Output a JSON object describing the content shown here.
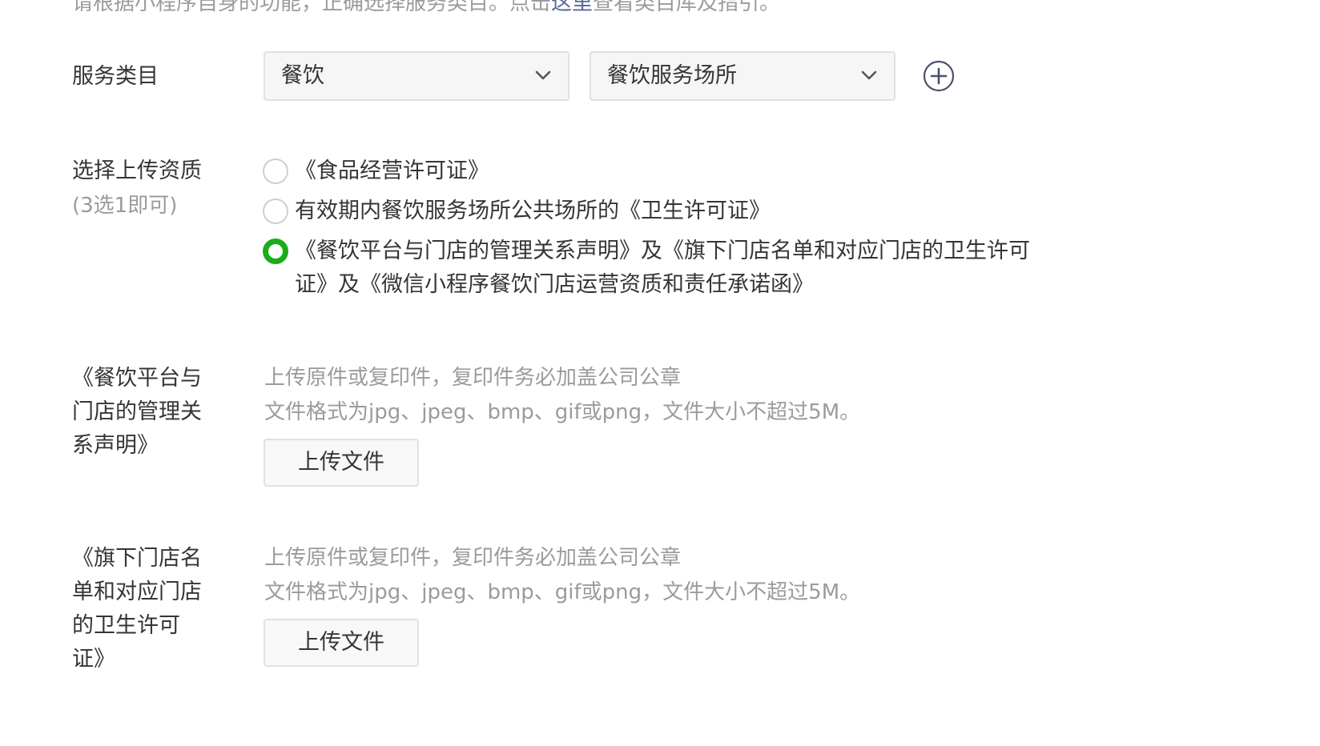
{
  "intro": {
    "text_before": "请根据小程序自身的功能，正确选择服务类目。点击",
    "link": "这里",
    "text_after": "查看类目库及指引。"
  },
  "service_category": {
    "label": "服务类目",
    "primary": "餐饮",
    "secondary": "餐饮服务场所"
  },
  "qualification": {
    "label": "选择上传资质",
    "sublabel": "(3选1即可)",
    "options": [
      {
        "text": "《食品经营许可证》",
        "checked": false
      },
      {
        "text": "有效期内餐饮服务场所公共场所的《卫生许可证》",
        "checked": false
      },
      {
        "text": "《餐饮平台与门店的管理关系声明》及《旗下门店名单和对应门店的卫生许可证》及《微信小程序餐饮门店运营资质和责任承诺函》",
        "checked": true
      }
    ]
  },
  "upload_sections": [
    {
      "label": "《餐饮平台与门店的管理关系声明》",
      "hint_1": "上传原件或复印件，复印件务必加盖公司公章",
      "hint_2": "文件格式为jpg、jpeg、bmp、gif或png，文件大小不超过5M。",
      "button": "上传文件"
    },
    {
      "label": "《旗下门店名单和对应门店的卫生许可证》",
      "hint_1": "上传原件或复印件，复印件务必加盖公司公章",
      "hint_2": "文件格式为jpg、jpeg、bmp、gif或png，文件大小不超过5M。",
      "button": "上传文件"
    }
  ],
  "colors": {
    "accent_green": "#1aad19",
    "link": "#576b95",
    "hint_gray": "#9b9b9b"
  },
  "icons": {
    "dropdown": "chevron-down-icon",
    "add": "plus-circle-icon"
  }
}
